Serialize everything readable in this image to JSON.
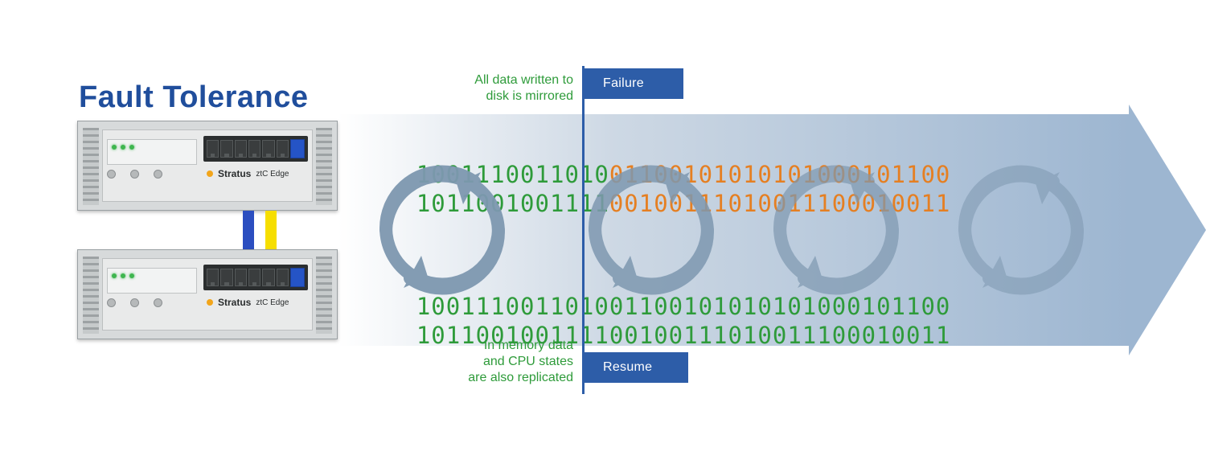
{
  "title": "Fault Tolerance",
  "note_top": "All data written to\ndisk is mirrored",
  "note_bottom": "In memory data\nand CPU states\nare also replicated",
  "flag_top": "Failure",
  "flag_bottom": "Resume",
  "device": {
    "brand": "Stratus",
    "model": "ztC Edge"
  },
  "binary": {
    "top_row1_before": "1001110011010",
    "top_row1_after": "01100101010101000101100",
    "top_row2_before": "1011001001111",
    "top_row2_after": "00100111010011100010011",
    "bottom_row1": "100111001101001100101010101000101100",
    "bottom_row2": "101100100111100100111010011100010011"
  }
}
